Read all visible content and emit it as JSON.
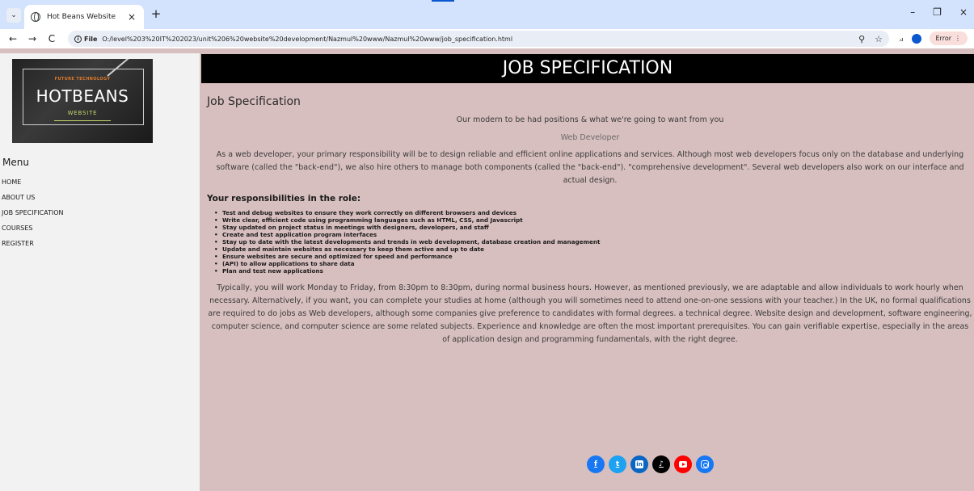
{
  "browser": {
    "tab_title": "Hot Beans Website",
    "url": "O:/level%203%20IT%202023/unit%206%20website%20development/Nazmul%20www/Nazmul%20www/job_specification.html",
    "file_chip": "File",
    "error_label": "Error",
    "info_glyph": "i",
    "tab_menu_glyph": "⌄",
    "tab_close_glyph": "×",
    "new_tab_glyph": "+",
    "back_glyph": "←",
    "forward_glyph": "→",
    "reload_glyph": "C",
    "zoom_glyph": "⚲",
    "star_glyph": "☆",
    "extensions_glyph": "⟓",
    "more_glyph": "⋮",
    "minimize_glyph": "–",
    "restore_glyph": "❐",
    "close_glyph": "×"
  },
  "logo": {
    "tagline": "FUTURE TECHNOLOGY",
    "name": "HOTBEANS",
    "sub": "WEBSITE"
  },
  "sidebar": {
    "menu_title": "Menu",
    "items": [
      {
        "label": "HOME"
      },
      {
        "label": "ABOUT US"
      },
      {
        "label": "JOB SPECIFICATION"
      },
      {
        "label": "COURSES"
      },
      {
        "label": "REGISTER"
      }
    ]
  },
  "header": {
    "title": "JOB SPECIFICATION"
  },
  "content": {
    "page_title": "Job Specification",
    "tagline": "Our modern to be had positions & what we're going to want from you",
    "role": "Web Developer",
    "intro": "As a web developer, your primary responsibility will be to design reliable and efficient online applications and services. Although most web developers focus only on the database and underlying software (called the \"back-end\"), we also hire others to manage both components (called the \"back-end\"). \"comprehensive development\". Several web developers also work on our interface and actual design.",
    "responsibilities_heading": "Your responsibilities in the role:",
    "responsibilities": [
      "Test and debug websites to ensure they work correctly on different browsers and devices",
      "Write clear, efficient code using programming languages such as HTML, CSS, and Javascript",
      "Stay updated on project status in meetings with designers, developers, and staff",
      "Create and test application program interfaces",
      "Stay up to date with the latest developments and trends in web development, database creation and management",
      "Update and maintain websites as necessary to keep them active and up to date",
      "Ensure websites are secure and optimized for speed and performance",
      "(API) to allow applications to share data",
      "Plan and test new applications"
    ],
    "closing": "Typically, you will work Monday to Friday, from 8:30pm to 8:30pm, during normal business hours. However, as mentioned previously, we are adaptable and allow individuals to work hourly when necessary. Alternatively, if you want, you can complete your studies at home (although you will sometimes need to attend one-on-one sessions with your teacher.) In the UK, no formal qualifications are required to do jobs as Web developers, although some companies give preference to candidates with formal degrees. a technical degree. Website design and development, software engineering, computer science, and computer science are some related subjects. Experience and knowledge are often the most important prerequisites. You can gain verifiable expertise, especially in the areas of application design and programming fundamentals, with the right degree."
  },
  "social": {
    "facebook_glyph": "f",
    "twitter_glyph": "t",
    "linkedin_glyph": "in",
    "tiktok_glyph": "♪"
  },
  "colors": {
    "page_bg": "#d8bfbf",
    "sidebar_bg": "#f2f2f2",
    "header_bg": "#000000",
    "facebook": "#1877f2",
    "twitter": "#1da1f2",
    "linkedin": "#0a66c2",
    "tiktok": "#000000",
    "youtube": "#ff0000",
    "instagram": "#1877f2"
  }
}
